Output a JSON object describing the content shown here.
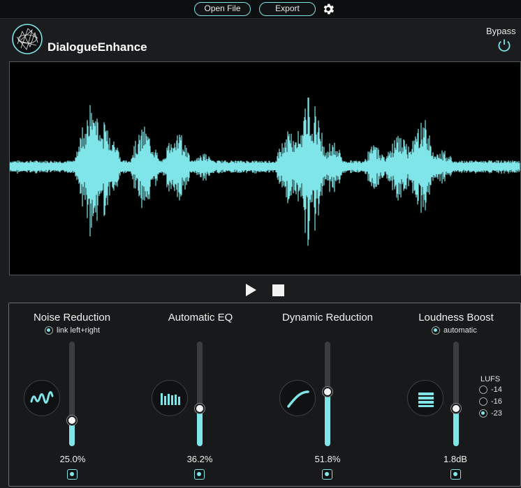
{
  "toolbar": {
    "open_file_label": "Open File",
    "export_label": "Export",
    "settings_icon": "gear-icon"
  },
  "header": {
    "app_title": "DialogueEnhance",
    "bypass_label": "Bypass",
    "bypass_icon": "power-icon",
    "logo_icon": "wireframe-globe-logo"
  },
  "waveform": {
    "color": "#7fe5e8",
    "background": "#000000"
  },
  "transport": {
    "play_icon": "play-icon",
    "stop_icon": "stop-icon"
  },
  "modules": [
    {
      "title": "Noise Reduction",
      "option_label": "link left+right",
      "option_checked": true,
      "icon": "noise-wave-icon",
      "value_label": "25.0%",
      "level": 0.25
    },
    {
      "title": "Automatic EQ",
      "icon": "eq-bars-icon",
      "value_label": "36.2%",
      "level": 0.362
    },
    {
      "title": "Dynamic Reduction",
      "icon": "compression-curve-icon",
      "value_label": "51.8%",
      "level": 0.518
    },
    {
      "title": "Loudness Boost",
      "option_label": "automatic",
      "option_checked": true,
      "icon": "stacked-bars-icon",
      "value_label": "1.8dB",
      "level": 0.36
    }
  ],
  "lufs": {
    "title": "LUFS",
    "options": [
      "-14",
      "-16",
      "-23"
    ],
    "selected": "-23"
  },
  "accent_color": "#7fe5e8"
}
